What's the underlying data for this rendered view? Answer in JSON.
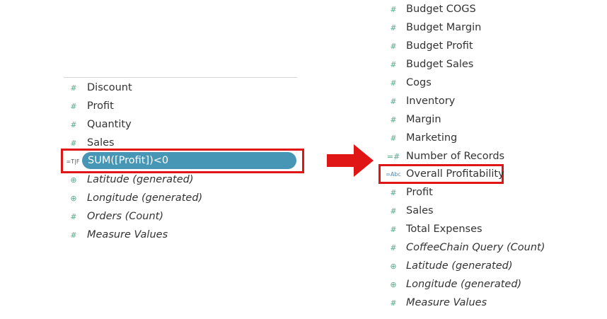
{
  "left_panel": {
    "items": [
      {
        "label": "Discount",
        "icon": "hash-icon",
        "italic": false
      },
      {
        "label": "Profit",
        "icon": "hash-icon",
        "italic": false
      },
      {
        "label": "Quantity",
        "icon": "hash-icon",
        "italic": false
      },
      {
        "label": "Sales",
        "icon": "hash-icon",
        "italic": false
      }
    ],
    "calc_field": {
      "label": "SUM([Profit])<0",
      "icon": "boolean-calc-icon",
      "icon_text": "=T|F"
    },
    "items_after": [
      {
        "label": "Latitude (generated)",
        "icon": "globe-icon",
        "italic": true
      },
      {
        "label": "Longitude (generated)",
        "icon": "globe-icon",
        "italic": true
      },
      {
        "label": "Orders (Count)",
        "icon": "hash-icon",
        "italic": true
      },
      {
        "label": "Measure Values",
        "icon": "hash-icon",
        "italic": true
      }
    ]
  },
  "right_panel": {
    "items": [
      {
        "label": "Budget COGS",
        "icon": "hash-icon",
        "italic": false
      },
      {
        "label": "Budget Margin",
        "icon": "hash-icon",
        "italic": false
      },
      {
        "label": "Budget Profit",
        "icon": "hash-icon",
        "italic": false
      },
      {
        "label": "Budget Sales",
        "icon": "hash-icon",
        "italic": false
      },
      {
        "label": "Cogs",
        "icon": "hash-icon",
        "italic": false
      },
      {
        "label": "Inventory",
        "icon": "hash-icon",
        "italic": false
      },
      {
        "label": "Margin",
        "icon": "hash-icon",
        "italic": false
      },
      {
        "label": "Marketing",
        "icon": "hash-icon",
        "italic": false
      },
      {
        "label": "Number of Records",
        "icon": "calc-hash-icon",
        "italic": false
      },
      {
        "label": "Overall Profitability",
        "icon": "string-calc-icon",
        "icon_text": "=Abc",
        "italic": false
      },
      {
        "label": "Profit",
        "icon": "hash-icon",
        "italic": false
      },
      {
        "label": "Sales",
        "icon": "hash-icon",
        "italic": false
      },
      {
        "label": "Total Expenses",
        "icon": "hash-icon",
        "italic": false
      },
      {
        "label": "CoffeeChain Query (Count)",
        "icon": "hash-icon",
        "italic": true
      },
      {
        "label": "Latitude (generated)",
        "icon": "globe-icon",
        "italic": true
      },
      {
        "label": "Longitude (generated)",
        "icon": "globe-icon",
        "italic": true
      },
      {
        "label": "Measure Values",
        "icon": "hash-icon",
        "italic": true
      }
    ]
  },
  "colors": {
    "highlight_border": "#e01515",
    "pill": "#4896b5",
    "arrow": "#e01515",
    "icon": "#5aa98a"
  }
}
